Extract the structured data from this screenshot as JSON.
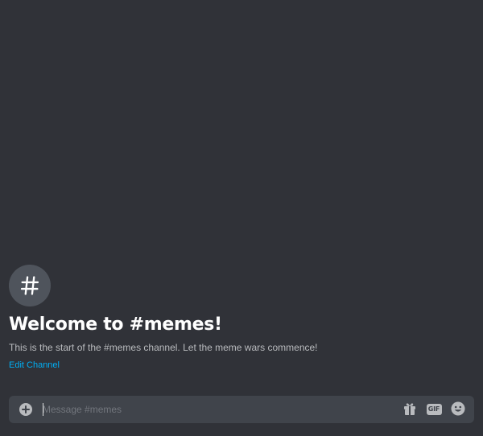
{
  "channel": {
    "icon": "hashtag-icon",
    "welcome_title": "Welcome to #memes!",
    "description": "This is the start of the #memes channel. Let the meme wars commence!",
    "edit_link": "Edit Channel"
  },
  "composer": {
    "placeholder": "Message #memes",
    "value": "",
    "icons": {
      "add": "plus-circle-icon",
      "gift": "gift-icon",
      "gif": "gif-icon",
      "emoji": "emoji-icon"
    },
    "gif_label": "GIF"
  },
  "colors": {
    "background": "#303238",
    "composer_bg": "#40444b",
    "link": "#00aff4",
    "title": "#ffffff",
    "text_muted": "#b9bbbe",
    "icon_bg": "#4f545c"
  }
}
